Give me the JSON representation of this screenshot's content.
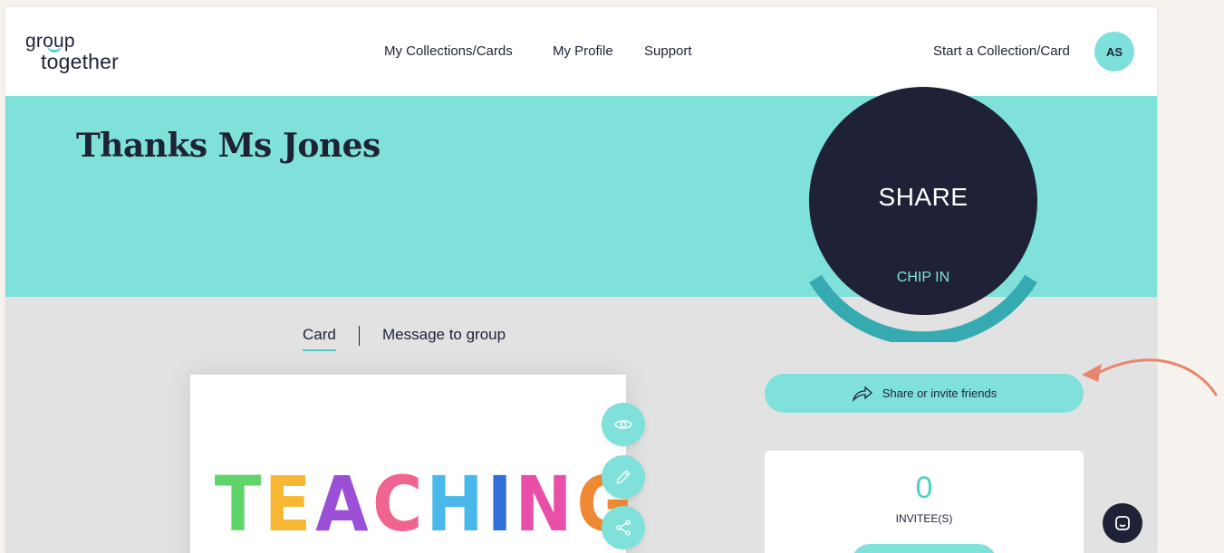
{
  "brand": {
    "logo_line1": "group",
    "logo_line2": "together"
  },
  "nav": {
    "collections": "My Collections/Cards",
    "profile": "My Profile",
    "support": "Support",
    "start": "Start a Collection/Card",
    "avatar_initials": "AS"
  },
  "banner": {
    "title": "Thanks Ms Jones"
  },
  "share_widget": {
    "share_label": "SHARE",
    "chip_label": "CHIP IN"
  },
  "tabs": {
    "card": "Card",
    "message": "Message to group"
  },
  "card_preview": {
    "letters": [
      {
        "char": "T",
        "color": "#5fd46a"
      },
      {
        "char": "E",
        "color": "#f7b733"
      },
      {
        "char": "A",
        "color": "#9a4fd6"
      },
      {
        "char": "C",
        "color": "#f0658f"
      },
      {
        "char": "H",
        "color": "#49b8e8"
      },
      {
        "char": "I",
        "color": "#2f6fd8"
      },
      {
        "char": "N",
        "color": "#e94fa8"
      },
      {
        "char": "G",
        "color": "#f08a32"
      }
    ],
    "actions": [
      "eye-icon",
      "pencil-icon",
      "share-icon"
    ]
  },
  "invite": {
    "button_label": "Share or invite friends",
    "count": "0",
    "count_label": "INVITEE(S)"
  },
  "colors": {
    "accent": "#7fe1da",
    "dark": "#1f2236",
    "annotation": "#e8866d"
  }
}
